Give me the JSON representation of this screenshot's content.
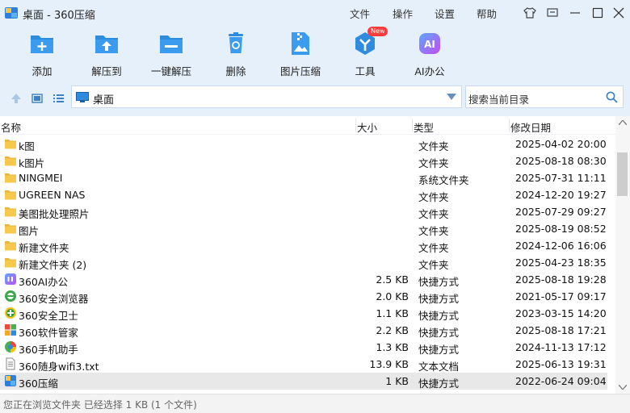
{
  "window": {
    "title": "桌面 - 360压缩",
    "menu": [
      "文件",
      "操作",
      "设置",
      "帮助"
    ]
  },
  "toolbar": {
    "items": [
      {
        "label": "添加",
        "icon": "add-archive-icon"
      },
      {
        "label": "解压到",
        "icon": "extract-to-icon"
      },
      {
        "label": "一键解压",
        "icon": "quick-extract-icon"
      },
      {
        "label": "删除",
        "icon": "delete-icon"
      },
      {
        "label": "图片压缩",
        "icon": "image-compress-icon"
      },
      {
        "label": "工具",
        "icon": "tools-icon"
      },
      {
        "label": "AI办公",
        "icon": "ai-office-icon"
      }
    ],
    "new_badge": "New",
    "ai_glyph": "AI"
  },
  "address": {
    "path": "桌面",
    "search_placeholder": "搜索当前目录"
  },
  "columns": {
    "name": "名称",
    "size": "大小",
    "type": "类型",
    "modified": "修改日期"
  },
  "files": [
    {
      "name": "k图",
      "size": "",
      "type": "文件夹",
      "date": "2025-04-02 20:00",
      "icon": "folder-icon"
    },
    {
      "name": "k图片",
      "size": "",
      "type": "文件夹",
      "date": "2025-08-18 08:30",
      "icon": "folder-icon"
    },
    {
      "name": "NINGMEI",
      "size": "",
      "type": "系统文件夹",
      "date": "2025-07-31 11:11",
      "icon": "folder-icon"
    },
    {
      "name": "UGREEN NAS",
      "size": "",
      "type": "文件夹",
      "date": "2024-12-20 19:27",
      "icon": "folder-icon"
    },
    {
      "name": "美图批处理照片",
      "size": "",
      "type": "文件夹",
      "date": "2025-07-29 09:27",
      "icon": "folder-icon"
    },
    {
      "name": "图片",
      "size": "",
      "type": "文件夹",
      "date": "2025-08-19 08:52",
      "icon": "folder-icon"
    },
    {
      "name": "新建文件夹",
      "size": "",
      "type": "文件夹",
      "date": "2024-12-06 16:06",
      "icon": "folder-icon"
    },
    {
      "name": "新建文件夹 (2)",
      "size": "",
      "type": "文件夹",
      "date": "2025-04-23 18:35",
      "icon": "folder-icon"
    },
    {
      "name": "360AI办公",
      "size": "2.5 KB",
      "type": "快捷方式",
      "date": "2025-08-18 19:28",
      "icon": "ai-app-icon"
    },
    {
      "name": "360安全浏览器",
      "size": "2.0 KB",
      "type": "快捷方式",
      "date": "2021-05-17 09:17",
      "icon": "browser-icon"
    },
    {
      "name": "360安全卫士",
      "size": "1.1 KB",
      "type": "快捷方式",
      "date": "2023-03-15 14:20",
      "icon": "security-guard-icon"
    },
    {
      "name": "360软件管家",
      "size": "2.2 KB",
      "type": "快捷方式",
      "date": "2025-08-18 17:21",
      "icon": "software-manager-icon"
    },
    {
      "name": "360手机助手",
      "size": "1.3 KB",
      "type": "快捷方式",
      "date": "2024-11-13 17:12",
      "icon": "phone-assistant-icon"
    },
    {
      "name": "360随身wifi3.txt",
      "size": "13.9 KB",
      "type": "文本文档",
      "date": "2025-06-13 19:31",
      "icon": "text-file-icon"
    },
    {
      "name": "360压缩",
      "size": "1 KB",
      "type": "快捷方式",
      "date": "2022-06-24 09:04",
      "icon": "zip-app-icon",
      "selected": true
    }
  ],
  "status": "您正在浏览文件夹 已经选择 1 KB (1 个文件)",
  "colors": {
    "accent": "#2e8bde",
    "chrome_bg": "#e6f0fb",
    "folder": "#f4c542"
  }
}
